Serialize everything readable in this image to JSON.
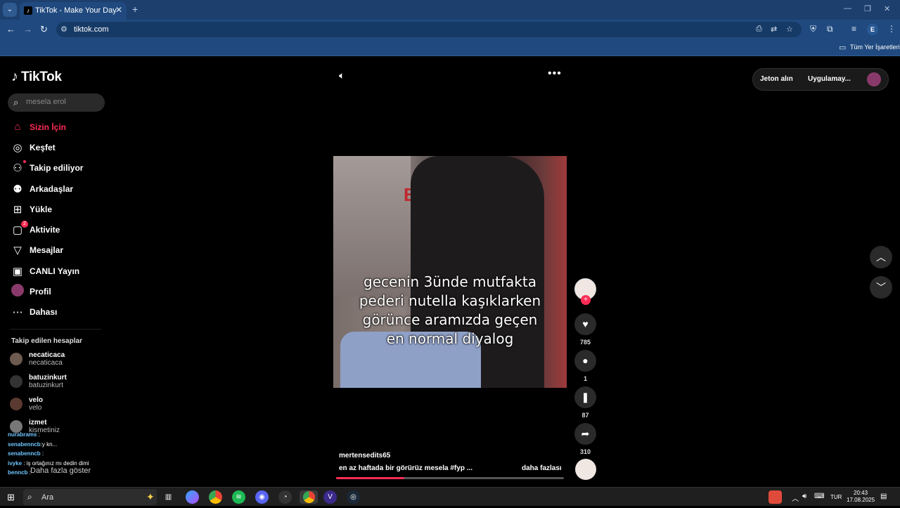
{
  "browser": {
    "tab_title": "TikTok - Make Your Day",
    "url": "tiktok.com",
    "bookmarks_label": "Tüm Yer İşaretleri",
    "profile_letter": "E"
  },
  "tiktok": {
    "logo_text": "TikTok",
    "search_placeholder": "mesela erol",
    "nav": [
      {
        "label": "Sizin İçin"
      },
      {
        "label": "Keşfet"
      },
      {
        "label": "Takip ediliyor"
      },
      {
        "label": "Arkadaşlar"
      },
      {
        "label": "Yükle"
      },
      {
        "label": "Aktivite",
        "badge": "2"
      },
      {
        "label": "Mesajlar"
      },
      {
        "label": "CANLI Yayın"
      },
      {
        "label": "Profil"
      },
      {
        "label": "Dahası"
      }
    ],
    "following_title": "Takip edilen hesaplar",
    "following": [
      {
        "name": "necaticaca",
        "handle": "necaticaca"
      },
      {
        "name": "batuzinkurt",
        "handle": "batuzinkurt"
      },
      {
        "name": "velo",
        "handle": "velo"
      },
      {
        "name": "izmet",
        "handle": "kismetiniz"
      }
    ],
    "chat": [
      {
        "user": "nurabrams",
        "msg": ":"
      },
      {
        "user": "senabenncb",
        "msg": ":y kn..."
      },
      {
        "user": "senabenncb",
        "msg": ":"
      },
      {
        "user": "ivyke",
        "msg": ": iş ortağınız mı dedin dimi"
      },
      {
        "user": "bennсb",
        "msg": ":"
      }
    ],
    "show_more": "Daha fazla göster",
    "top_actions": {
      "coins": "Jeton alın",
      "app": "Uygulamay..."
    },
    "video": {
      "sign_text": "B",
      "overlay_lines": [
        "gecenin 3ünde mutfakta",
        "pederi nutella kaşıklarken",
        "görünce aramızda geçen",
        "en normal diyalog"
      ],
      "author": "mertensedits65",
      "description": "en az haftada bir görürüz mesela #fyp ...",
      "more": "daha fazlası",
      "progress": 0.3
    },
    "counts": {
      "likes": "785",
      "comments": "1",
      "saves": "87",
      "shares": "310"
    }
  },
  "taskbar": {
    "search_label": "Ara",
    "language": "TUR",
    "time": "20:43",
    "date": "17.08.2025"
  }
}
